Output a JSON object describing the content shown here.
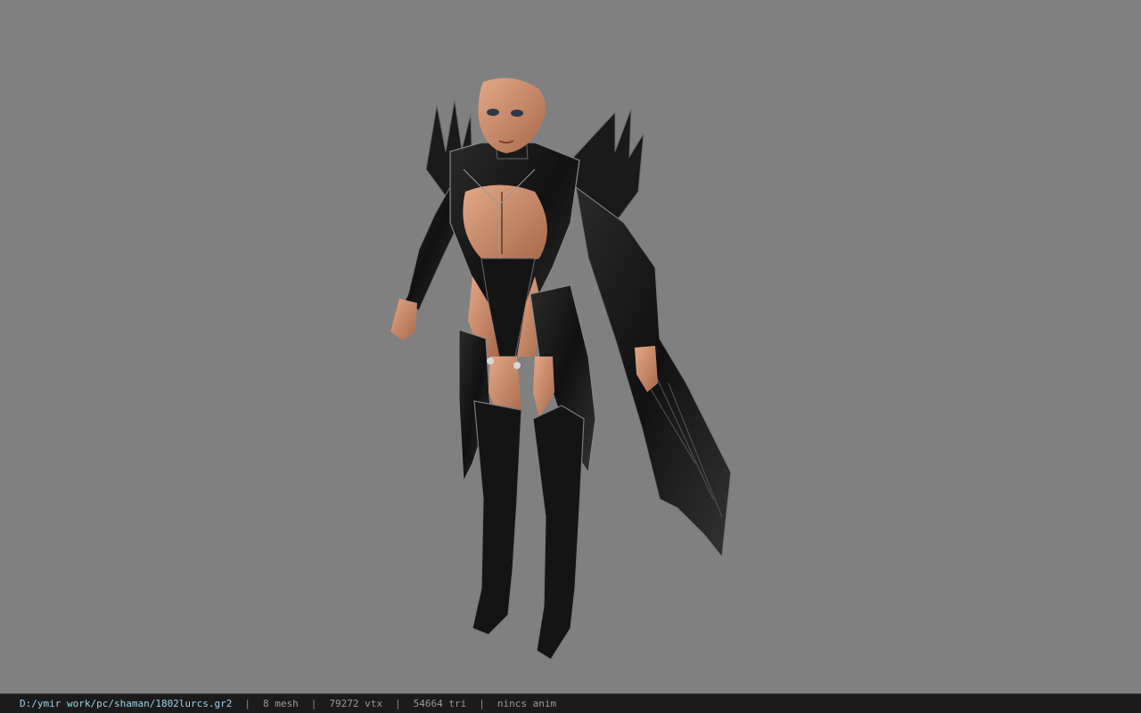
{
  "viewer": {
    "background_color": "#808080",
    "model_icon": "character-model-icon"
  },
  "status": {
    "file_path": "D:/ymir work/pc/shaman/1802lurcs.gr2",
    "separator": "|",
    "mesh_count": "8 mesh",
    "vertex_count": "79272 vtx",
    "triangle_count": "54664 tri",
    "anim_status": "nincs anim",
    "path_color": "#9fd0ee"
  }
}
